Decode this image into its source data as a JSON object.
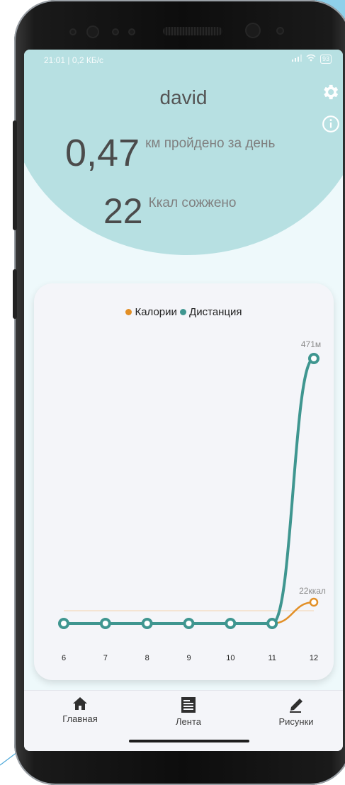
{
  "status_bar": {
    "time_speed": "21:01 | 0,2 КБ/с",
    "battery": "93"
  },
  "profile": {
    "username": "david"
  },
  "stats": {
    "distance_value": "0,47",
    "distance_label": "км пройдено за день",
    "calories_value": "22",
    "calories_label": "Ккал сожжено"
  },
  "chart_data": {
    "type": "line",
    "categories": [
      "6",
      "7",
      "8",
      "9",
      "10",
      "11",
      "12"
    ],
    "series": [
      {
        "name": "Калории",
        "values": [
          0,
          0,
          0,
          0,
          0,
          0,
          22
        ],
        "color": "#e28f26",
        "end_label": "22ккал"
      },
      {
        "name": "Дистанция",
        "values": [
          0,
          0,
          0,
          0,
          0,
          0,
          471
        ],
        "color": "#3f9690",
        "end_label": "471м"
      }
    ],
    "legend": {
      "placement": "top-center"
    },
    "grid": false
  },
  "nav": {
    "items": [
      {
        "label": "Главная",
        "icon": "home-icon"
      },
      {
        "label": "Лента",
        "icon": "feed-icon"
      },
      {
        "label": "Рисунки",
        "icon": "pencil-icon"
      }
    ]
  },
  "colors": {
    "header_blob": "#b7e0e2",
    "calories": "#e28f26",
    "distance": "#3f9690"
  }
}
